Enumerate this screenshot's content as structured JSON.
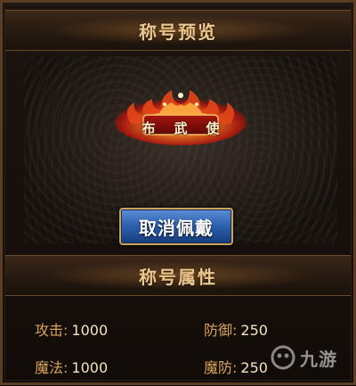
{
  "preview_header": {
    "title": "称号预览"
  },
  "title_badge": {
    "chars": [
      "布",
      "武",
      "使"
    ]
  },
  "cancel_button": {
    "label": "取消佩戴"
  },
  "attributes_header": {
    "title": "称号属性"
  },
  "attributes": {
    "attack": {
      "label": "攻击:",
      "value": "1000"
    },
    "defense": {
      "label": "防御:",
      "value": "250"
    },
    "magic": {
      "label": "魔法:",
      "value": "1000"
    },
    "magic_defense": {
      "label": "魔防:",
      "value": "250"
    }
  },
  "watermark": {
    "text": "九游"
  },
  "colors": {
    "label_gold": "#d9a35a",
    "value_cream": "#f4e2c4",
    "title_cream": "#f1d7a8",
    "button_blue": "#2b5fae"
  }
}
